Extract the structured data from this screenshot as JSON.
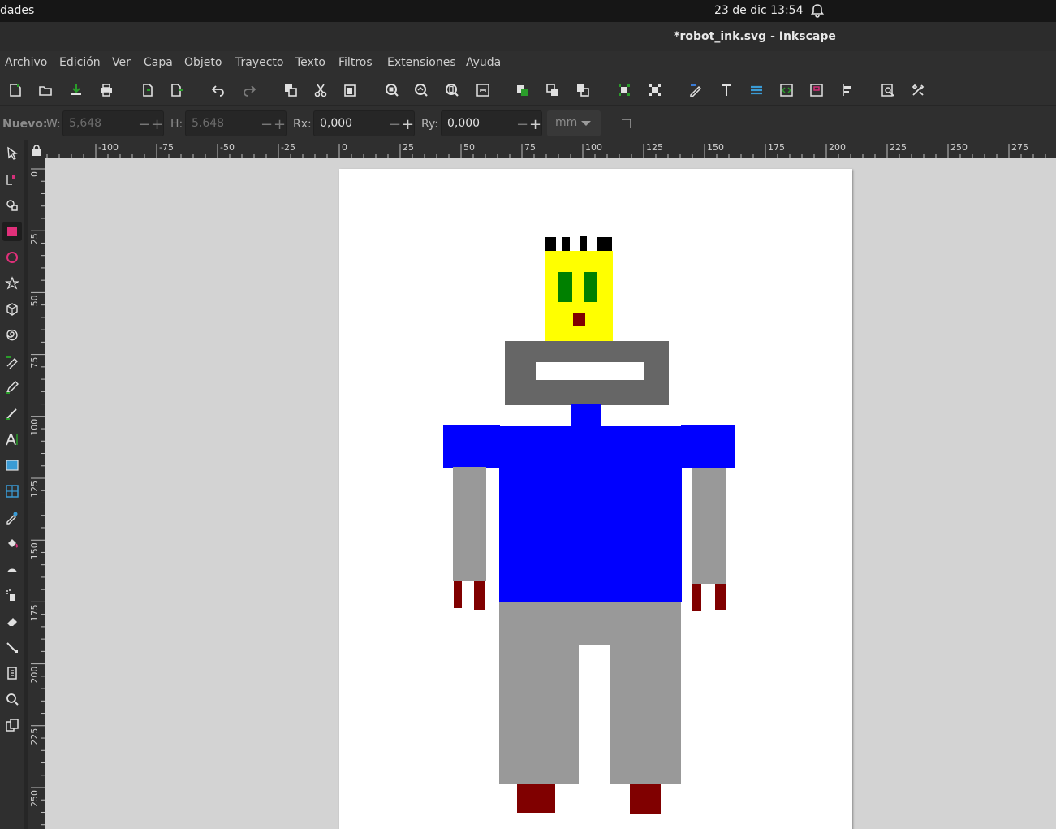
{
  "system_bar": {
    "left_text": "dades",
    "clock": "23 de dic  13:54"
  },
  "window": {
    "title": "*robot_ink.svg - Inkscape"
  },
  "menu": [
    {
      "label": "Archivo"
    },
    {
      "label": "Edición"
    },
    {
      "label": "Ver"
    },
    {
      "label": "Capa"
    },
    {
      "label": "Objeto"
    },
    {
      "label": "Trayecto"
    },
    {
      "label": "Texto"
    },
    {
      "label": "Filtros"
    },
    {
      "label": "Extensiones"
    },
    {
      "label": "Ayuda"
    }
  ],
  "tool_controls": {
    "mode_label": "Nuevo:",
    "w_label": "W:",
    "w_value": "5,648",
    "h_label": "H:",
    "h_value": "5,648",
    "rx_label": "Rx:",
    "rx_value": "0,000",
    "ry_label": "Ry:",
    "ry_value": "0,000",
    "unit": "mm"
  },
  "ruler": {
    "horizontal_labels": [
      "-100",
      "-75",
      "-50",
      "-25",
      "0",
      "25",
      "50",
      "75",
      "100",
      "125",
      "150",
      "175",
      "200",
      "225",
      "250",
      "275"
    ],
    "vertical_labels": [
      "0",
      "25",
      "50",
      "75",
      "100",
      "125",
      "150",
      "175",
      "200",
      "225",
      "250"
    ]
  },
  "drawing_colors": {
    "hair": "#000000",
    "head": "#ffff00",
    "eyes": "#008000",
    "mouth": "#800000",
    "neck_frame": "#666666",
    "body": "#0000ff",
    "arms_legs": "#999999",
    "hands_feet": "#800000",
    "page": "#ffffff",
    "canvas": "#d3d3d3"
  }
}
